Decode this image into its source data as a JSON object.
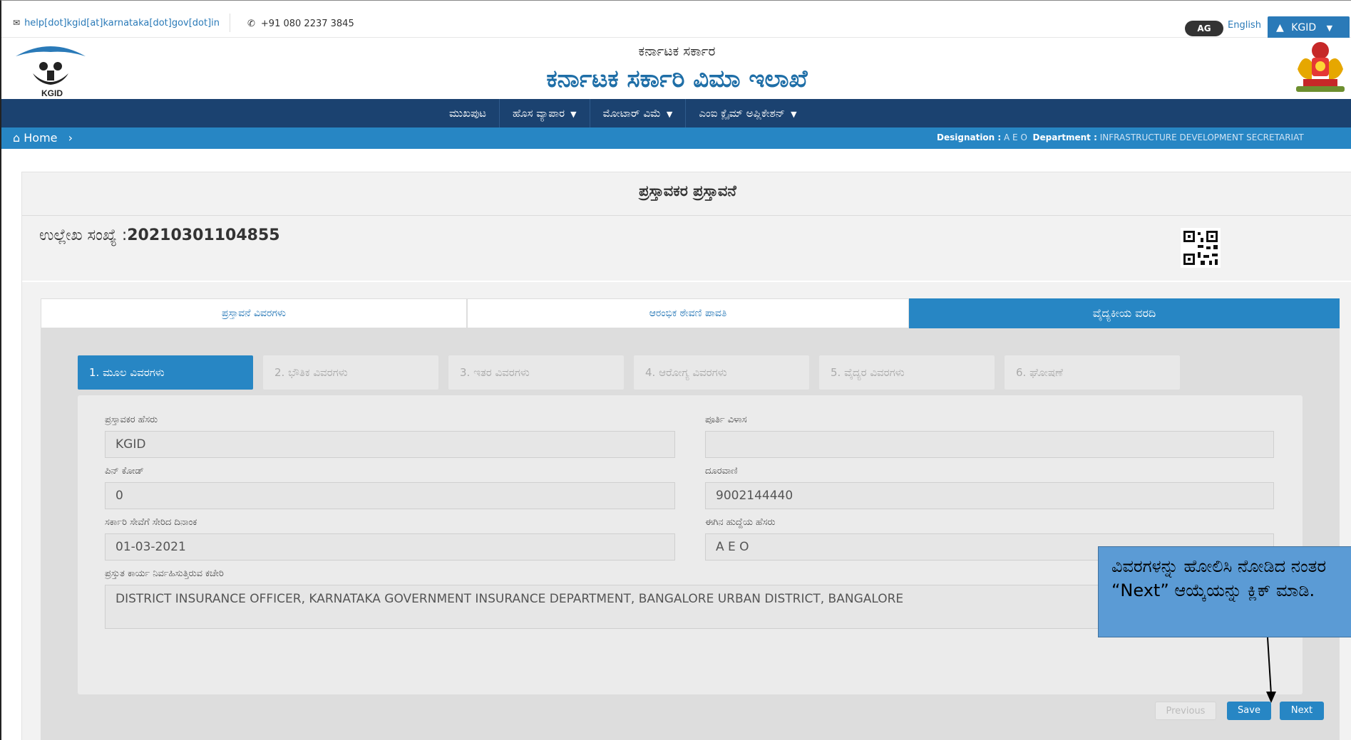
{
  "topbar": {
    "email": "help[dot]kgid[at]karnataka[dot]gov[dot]in",
    "phone": "+91 080 2237 3845",
    "lang_icon": "AG",
    "language": "English",
    "user": "KGID"
  },
  "header": {
    "subtitle": "ಕರ್ನಾಟಕ ಸರ್ಕಾರ",
    "title": "ಕರ್ನಾಟಕ ಸರ್ಕಾರಿ ವಿಮಾ ಇಲಾಖೆ",
    "logo_text": "KGID"
  },
  "nav": {
    "items": [
      "ಮುಖಪುಟ",
      "ಹೊಸ ವ್ಯಾಪಾರ",
      "ಮೋಟಾರ್ ವಿಮೆ",
      "ಎಂಐ ಕ್ಲೈಮ್ ಅಪ್ಲಿಕೇಶನ್"
    ]
  },
  "breadcrumb": {
    "home": "Home",
    "designation_label": "Designation :",
    "designation": "A E O",
    "department_label": "Department :",
    "department": "INFRASTRUCTURE DEVELOPMENT SECRETARIAT"
  },
  "card": {
    "heading": "ಪ್ರಸ್ತಾವಕರ ಪ್ರಸ್ತಾವನೆ",
    "ref_label": "ಉಲ್ಲೇಖ ಸಂಖ್ಯೆ :",
    "ref_number": "20210301104855"
  },
  "tabs": [
    {
      "label": "ಪ್ರಸ್ತಾವನೆ ವಿವರಗಳು",
      "active": false
    },
    {
      "label": "ಆರಂಭಿಕ ಠೇವಣಿ ಪಾವತಿ",
      "active": false
    },
    {
      "label": "ವೈದ್ಯಕೀಯ ವರದಿ",
      "active": true
    }
  ],
  "steps": [
    {
      "label": "1. ಮೂಲ ವಿವರಗಳು",
      "active": true
    },
    {
      "label": "2. ಭೌತಿಕ ವಿವರಗಳು",
      "active": false
    },
    {
      "label": "3. ಇತರ ವಿವರಗಳು",
      "active": false
    },
    {
      "label": "4. ಆರೋಗ್ಯ ವಿವರಗಳು",
      "active": false
    },
    {
      "label": "5. ವೈದ್ಯರ ವಿವರಗಳು",
      "active": false
    },
    {
      "label": "6. ಘೋಷಣೆ",
      "active": false
    }
  ],
  "form": {
    "proposer_name_label": "ಪ್ರಸ್ತಾವಕರ ಹೆಸರು",
    "proposer_name": "KGID",
    "full_address_label": "ಪೂರ್ತಿ ವಿಳಾಸ",
    "full_address": "",
    "pin_code_label": "ಪಿನ್ ಕೋಡ್",
    "pin_code": "0",
    "phone_label": "ದೂರವಾಣಿ",
    "phone": "9002144440",
    "join_date_label": "ಸರ್ಕಾರಿ ಸೇವೆಗೆ ಸೇರಿದ ದಿನಾಂಕ",
    "join_date": "01-03-2021",
    "designation_label": "ಈಗಿನ ಹುದ್ದೆಯ ಹೆಸರು",
    "designation": "A E O",
    "office_label": "ಪ್ರಸ್ತುತ ಕಾರ್ಯ ನಿರ್ವಹಿಸುತ್ತಿರುವ ಕಚೇರಿ",
    "office": "DISTRICT INSURANCE OFFICER, KARNATAKA GOVERNMENT INSURANCE DEPARTMENT, BANGALORE URBAN DISTRICT, BANGALORE"
  },
  "buttons": {
    "previous": "Previous",
    "save": "Save",
    "next": "Next"
  },
  "callout": {
    "text": "ವಿವರಗಳನ್ನು ಹೋಲಿಸಿ ನೋಡಿದ ನಂತರ “Next” ಆಯ್ಕೆಯನ್ನು ಕ್ಲಿಕ್ ಮಾಡಿ."
  },
  "colors": {
    "nav_bg": "#1b4270",
    "accent": "#2786c4",
    "callout_bg": "#5b9bd5"
  }
}
